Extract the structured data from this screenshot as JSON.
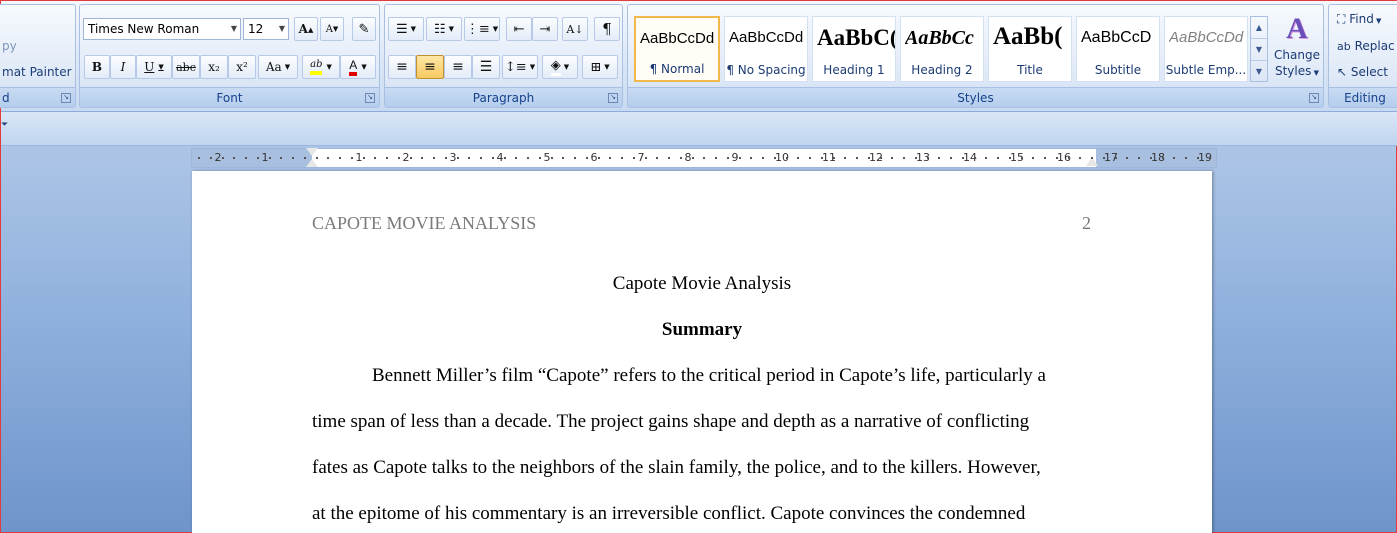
{
  "clipboard": {
    "copy_label": "py",
    "format_painter_label": "mat Painter",
    "group_label": "d"
  },
  "font": {
    "family": "Times New Roman",
    "size": "12",
    "group_label": "Font",
    "grow_label": "A",
    "shrink_label": "A",
    "bold": "B",
    "italic": "I",
    "underline": "U",
    "strike": "abc",
    "subscript": "x₂",
    "superscript": "x²",
    "change_case": "Aa",
    "highlight": "ab",
    "font_color": "A"
  },
  "paragraph": {
    "group_label": "Paragraph",
    "pilcrow": "¶"
  },
  "styles": {
    "group_label": "Styles",
    "items": [
      {
        "sample": "AaBbCcDd",
        "name": "¶ Normal"
      },
      {
        "sample": "AaBbCcDd",
        "name": "¶ No Spacing"
      },
      {
        "sample": "AaBbC(",
        "name": "Heading 1"
      },
      {
        "sample": "AaBbCc",
        "name": "Heading 2"
      },
      {
        "sample": "AaBb(",
        "name": "Title"
      },
      {
        "sample": "AaBbCcD",
        "name": "Subtitle"
      },
      {
        "sample": "AaBbCcDd",
        "name": "Subtle Emp..."
      }
    ],
    "change_styles_line1": "Change",
    "change_styles_line2": "Styles"
  },
  "editing": {
    "group_label": "Editing",
    "find": "Find",
    "replace": "Replac",
    "select": "Select"
  },
  "ruler": {
    "labels": [
      "2",
      "1",
      "1",
      "2",
      "3",
      "4",
      "5",
      "6",
      "7",
      "8",
      "9",
      "10",
      "11",
      "12",
      "13",
      "14",
      "15",
      "16",
      "17",
      "18",
      "19"
    ]
  },
  "document": {
    "header": "CAPOTE MOVIE ANALYSIS",
    "page_number": "2",
    "title": "Capote Movie Analysis",
    "summary_heading": "Summary",
    "lines": [
      "Bennett Miller’s film “Capote” refers to the critical period in Capote’s life, particularly a",
      "time span of less than a decade. The project gains shape and depth as a narrative of conflicting",
      "fates as Capote talks to the neighbors of the slain family, the police, and to the killers. However,",
      "at the epitome of his commentary is an irreversible conflict. Capote convinces the condemned"
    ]
  }
}
